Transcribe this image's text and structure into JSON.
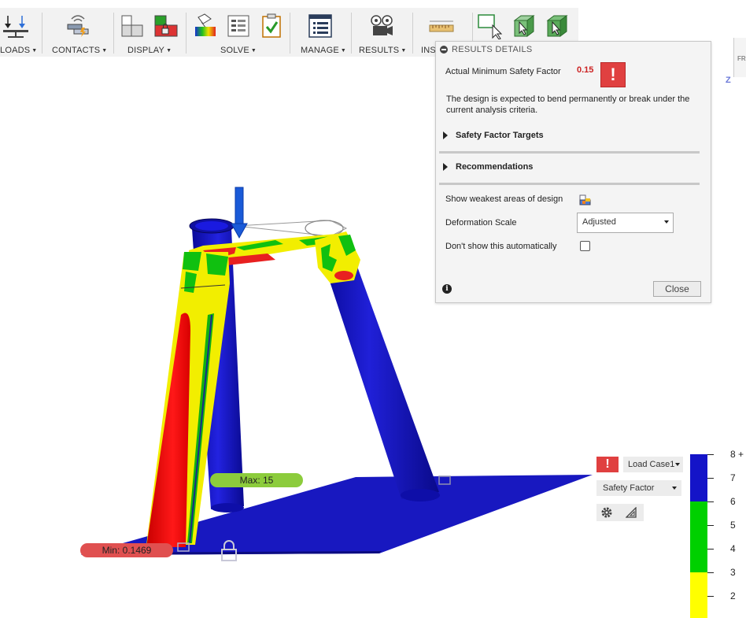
{
  "toolbar": {
    "groups": [
      {
        "label": "LOADS"
      },
      {
        "label": "CONTACTS"
      },
      {
        "label": "DISPLAY"
      },
      {
        "label": "SOLVE"
      },
      {
        "label": "MANAGE"
      },
      {
        "label": "RESULTS"
      },
      {
        "label": "INSI"
      }
    ]
  },
  "results_panel": {
    "title": "RESULTS DETAILS",
    "min_safety_label": "Actual Minimum Safety Factor",
    "min_safety_value": "0.15",
    "warning_glyph": "!",
    "message": "The design is expected to bend permanently or break under the current analysis criteria.",
    "sections": [
      {
        "label": "Safety Factor Targets"
      },
      {
        "label": "Recommendations"
      }
    ],
    "show_weakest_label": "Show weakest areas of design",
    "deformation_label": "Deformation Scale",
    "deformation_value": "Adjusted",
    "dont_show_label": "Don't show this automatically",
    "dont_show_checked": false,
    "info_glyph": "i",
    "close_label": "Close"
  },
  "model": {
    "max_label": "Max: 15",
    "min_label": "Min: 0.1469"
  },
  "legend": {
    "warning_glyph": "!",
    "load_case": "Load Case1",
    "result_type": "Safety Factor",
    "settings_icon": "gear-icon",
    "scale_icon": "triangle-ruler-icon",
    "ticks": [
      "8 +",
      "7",
      "6",
      "5",
      "4",
      "3",
      "2"
    ],
    "colors": {
      "safe": "#1414c8",
      "marginal": "#00d000",
      "low": "#ffff00"
    }
  },
  "view_cube": {
    "axis_label": "Z",
    "face_label": "FR"
  },
  "colors": {
    "red": "#e82020",
    "yellow": "#f4f000",
    "green": "#10c010",
    "blue": "#1414c8",
    "max_pill": "#8ccc3c",
    "min_pill": "#e05050"
  }
}
